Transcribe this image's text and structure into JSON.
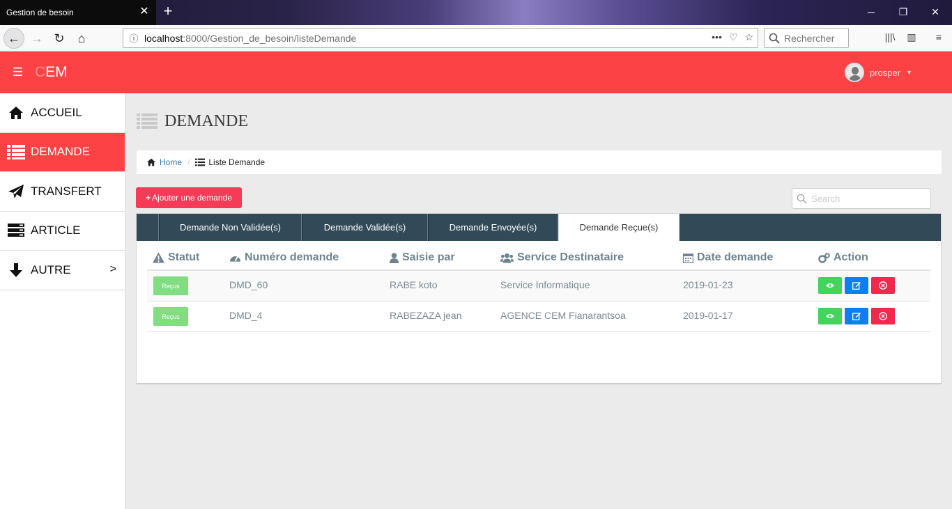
{
  "browser": {
    "tab_title": "Gestion de besoin",
    "url_host": "localhost",
    "url_path": ":8000/Gestion_de_besoin/listeDemande",
    "search_placeholder": "Rechercher"
  },
  "header": {
    "brand": "CEM",
    "username": "prosper",
    "accent_color": "#fc4244"
  },
  "sidebar": {
    "items": [
      {
        "label": "ACCUEIL",
        "icon": "home-icon"
      },
      {
        "label": "DEMANDE",
        "icon": "list-icon",
        "active": true
      },
      {
        "label": "TRANSFERT",
        "icon": "paper-plane-icon"
      },
      {
        "label": "ARTICLE",
        "icon": "server-icon"
      },
      {
        "label": "AUTRE",
        "icon": "arrow-down-icon",
        "chevron": ">"
      }
    ]
  },
  "page": {
    "title": "DEMANDE",
    "breadcrumb": {
      "home": "Home",
      "current": "Liste Demande"
    },
    "add_button": "Ajouter une demande",
    "search_placeholder": "Search"
  },
  "tabs": [
    {
      "label": "Demande Non Validée(s)"
    },
    {
      "label": "Demande Validée(s)"
    },
    {
      "label": "Demande Envoyée(s)"
    },
    {
      "label": "Demande Reçue(s)",
      "active": true
    }
  ],
  "table": {
    "columns": [
      "Statut",
      "Numéro demande",
      "Saisie par",
      "Service Destinataire",
      "Date demande",
      "Action"
    ],
    "rows": [
      {
        "statut": "Reçus",
        "numero": "DMD_60",
        "saisie": "RABE koto",
        "service": "Service Informatique",
        "date": "2019-01-23"
      },
      {
        "statut": "Reçus",
        "numero": "DMD_4",
        "saisie": "RABEZAZA jean",
        "service": "AGENCE CEM Fianarantsoa",
        "date": "2019-01-17"
      }
    ]
  }
}
